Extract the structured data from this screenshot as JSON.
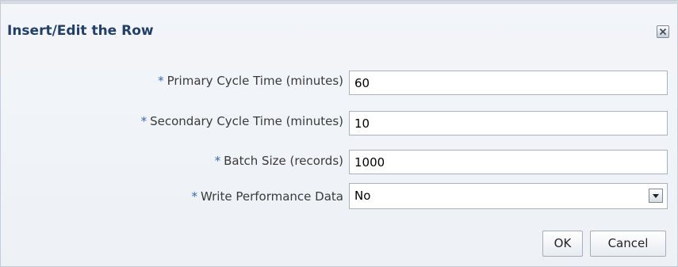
{
  "dialog": {
    "title": "Insert/Edit the Row",
    "close_icon": "close-icon"
  },
  "form": {
    "required_marker": "*",
    "rows": [
      {
        "label": "Primary Cycle Time (minutes)",
        "value": "60"
      },
      {
        "label": "Secondary Cycle Time (minutes)",
        "value": "10"
      },
      {
        "label": "Batch Size (records)",
        "value": "1000"
      },
      {
        "label": "Write Performance Data",
        "value": "No",
        "icon": "chevron-down-icon"
      }
    ]
  },
  "buttons": {
    "ok_label": "OK",
    "cancel_label": "Cancel"
  },
  "colors": {
    "title": "#223f66",
    "required_marker": "#3867b5",
    "background": "#eef2f7"
  }
}
